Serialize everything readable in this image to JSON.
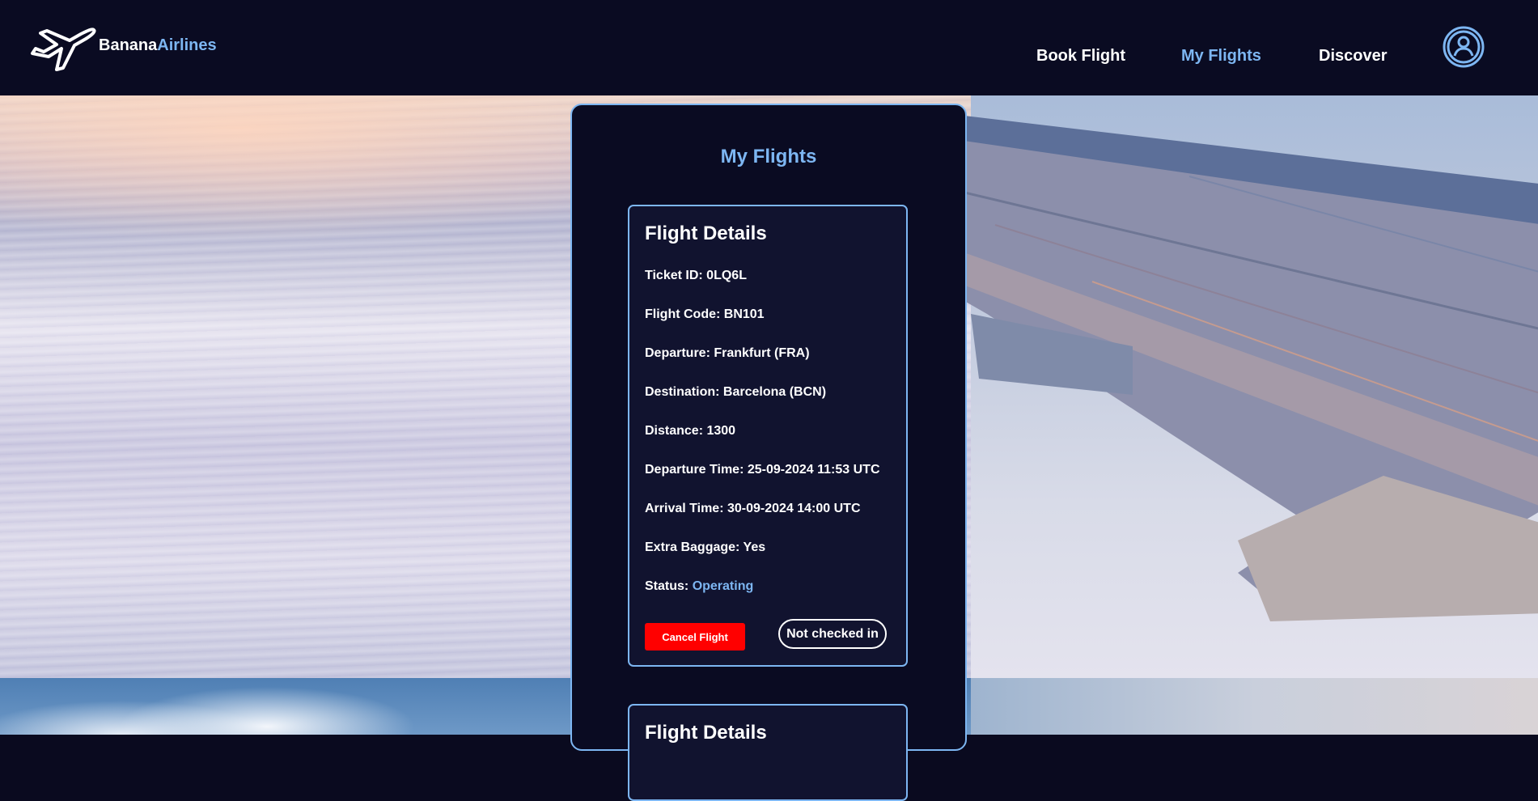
{
  "header": {
    "brand_primary": "Banana",
    "brand_accent": "Airlines",
    "nav": [
      {
        "label": "Book Flight",
        "active": false
      },
      {
        "label": "My Flights",
        "active": true
      },
      {
        "label": "Discover",
        "active": false
      }
    ],
    "profile_icon": "user-circle-icon",
    "logo_icon": "airplane-icon"
  },
  "colors": {
    "background": "#0a0b22",
    "accent": "#7db6f2",
    "danger": "#ff0000",
    "card": "#11132f"
  },
  "page": {
    "title": "My Flights"
  },
  "flights": [
    {
      "heading": "Flight Details",
      "ticket_id": "Ticket ID: 0LQ6L",
      "flight_code": "Flight Code: BN101",
      "departure": "Departure: Frankfurt (FRA)",
      "destination": "Destination: Barcelona (BCN)",
      "distance": "Distance: 1300",
      "departure_time": "Departure Time: 25-09-2024 11:53 UTC",
      "arrival_time": "Arrival Time: 30-09-2024 14:00 UTC",
      "extra_baggage": "Extra Baggage: Yes",
      "status_label": "Status:",
      "status_value": "Operating",
      "cancel_label": "Cancel Flight",
      "checkin_label": "Not checked in"
    },
    {
      "heading": "Flight Details"
    }
  ]
}
